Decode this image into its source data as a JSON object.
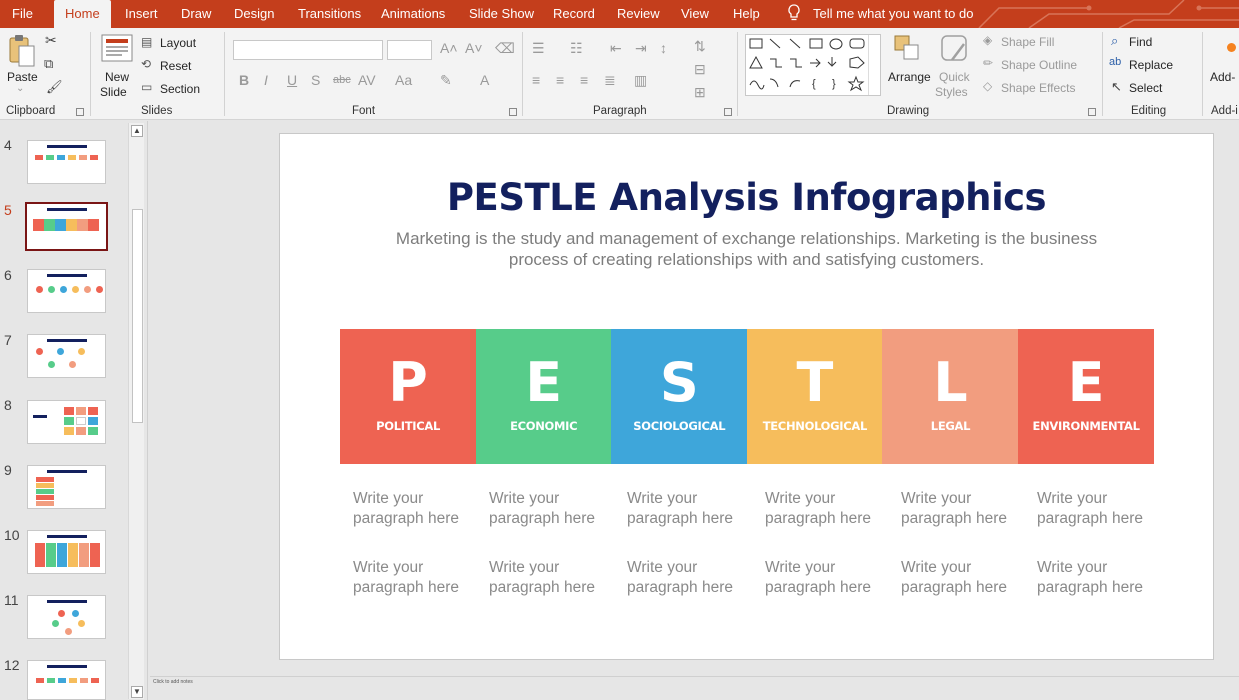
{
  "tabs": {
    "file": "File",
    "home": "Home",
    "insert": "Insert",
    "draw": "Draw",
    "design": "Design",
    "transitions": "Transitions",
    "animations": "Animations",
    "slideshow": "Slide Show",
    "record": "Record",
    "review": "Review",
    "view": "View",
    "help": "Help",
    "tellme": "Tell me what you want to do"
  },
  "ribbon": {
    "clipboard": {
      "paste": "Paste",
      "label": "Clipboard"
    },
    "slides": {
      "new_slide_1": "New",
      "new_slide_2": "Slide",
      "layout": "Layout",
      "reset": "Reset",
      "section": "Section",
      "label": "Slides"
    },
    "font": {
      "label": "Font"
    },
    "paragraph": {
      "label": "Paragraph"
    },
    "drawing": {
      "arrange": "Arrange",
      "quick_styles_1": "Quick",
      "quick_styles_2": "Styles",
      "shape_fill": "Shape Fill",
      "shape_outline": "Shape Outline",
      "shape_effects": "Shape Effects",
      "label": "Drawing"
    },
    "editing": {
      "find": "Find",
      "replace": "Replace",
      "select": "Select",
      "label": "Editing"
    },
    "addins": {
      "addin": "Add-",
      "label": "Add-i"
    }
  },
  "thumbnails": {
    "numbers": [
      "4",
      "5",
      "6",
      "7",
      "8",
      "9",
      "10",
      "11",
      "12"
    ],
    "active": "5"
  },
  "slide": {
    "title": "PESTLE Analysis Infographics",
    "subtitle": "Marketing is the study and management of exchange relationships. Marketing is the business process of creating relationships with and satisfying customers.",
    "cards": [
      {
        "letter": "P",
        "word": "POLITICAL",
        "color": "#ee6352"
      },
      {
        "letter": "E",
        "word": "ECONOMIC",
        "color": "#57cc8a"
      },
      {
        "letter": "S",
        "word": "SOCIOLOGICAL",
        "color": "#3ea6da"
      },
      {
        "letter": "T",
        "word": "TECHNOLOGICAL",
        "color": "#f6bd5c"
      },
      {
        "letter": "L",
        "word": "LEGAL",
        "color": "#f29d7f"
      },
      {
        "letter": "E",
        "word": "ENVIRONMENTAL",
        "color": "#ee6352"
      }
    ],
    "paragraph_placeholder_1": "Write your",
    "paragraph_placeholder_2": "paragraph here"
  },
  "status": {
    "notes": "Click to add notes"
  },
  "colors": {
    "accent": "#c43e1c",
    "title": "#13205e"
  }
}
